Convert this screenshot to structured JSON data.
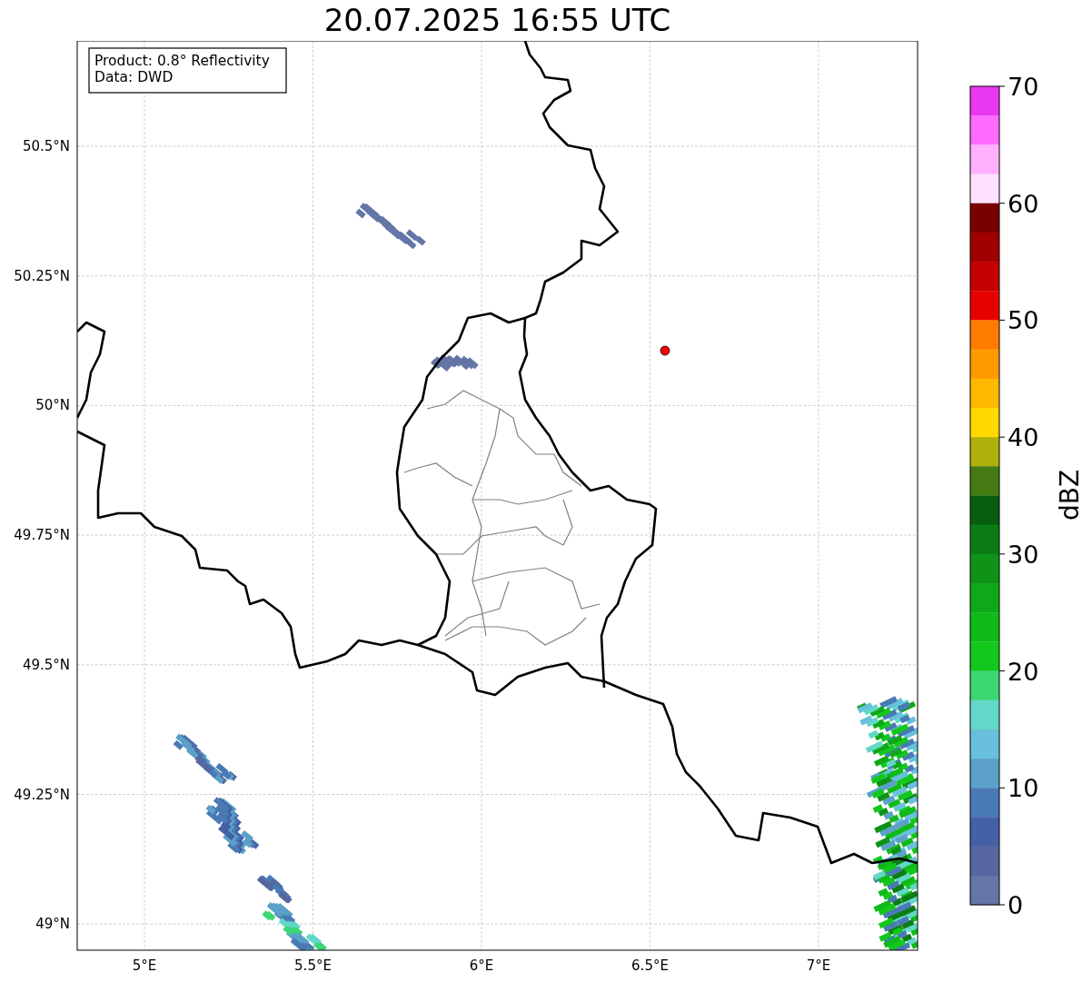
{
  "title": "20.07.2025 16:55 UTC",
  "info_box": [
    "Product: 0.8° Reflectivity",
    "Data: DWD"
  ],
  "map": {
    "x_ticks": [
      "5°E",
      "5.5°E",
      "6°E",
      "6.5°E",
      "7°E"
    ],
    "y_ticks": [
      "50.5°N",
      "50.25°N",
      "50°N",
      "49.75°N",
      "49.5°N",
      "49.25°N",
      "49°N"
    ]
  },
  "colorbar": {
    "label": "dBZ",
    "ticks": [
      "70",
      "60",
      "50",
      "40",
      "30",
      "20",
      "10",
      "0"
    ],
    "segments": [
      {
        "color": "#e838f0"
      },
      {
        "color": "#ff6aff"
      },
      {
        "color": "#ffb0ff"
      },
      {
        "color": "#ffe0ff"
      },
      {
        "color": "#7a0000"
      },
      {
        "color": "#a00000"
      },
      {
        "color": "#c40000"
      },
      {
        "color": "#e80000"
      },
      {
        "color": "#ff7c00"
      },
      {
        "color": "#ff9a00"
      },
      {
        "color": "#ffb800"
      },
      {
        "color": "#ffd800"
      },
      {
        "color": "#b0b00a"
      },
      {
        "color": "#457a12"
      },
      {
        "color": "#085e10"
      },
      {
        "color": "#0c7c14"
      },
      {
        "color": "#0e9218"
      },
      {
        "color": "#0fa818"
      },
      {
        "color": "#10ba18"
      },
      {
        "color": "#12c81c"
      },
      {
        "color": "#3cd672"
      },
      {
        "color": "#62d8c8"
      },
      {
        "color": "#68c0dd"
      },
      {
        "color": "#5ba0c8"
      },
      {
        "color": "#4a7ab5"
      },
      {
        "color": "#4460a6"
      },
      {
        "color": "#5566a0"
      },
      {
        "color": "#6475a6"
      }
    ]
  }
}
